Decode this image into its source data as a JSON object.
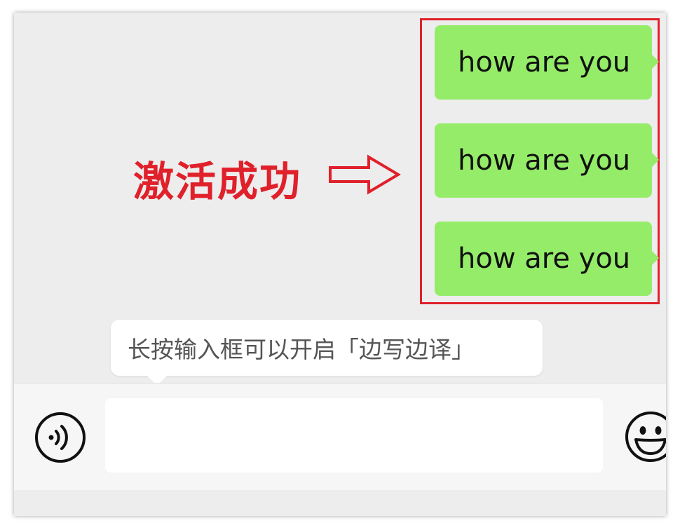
{
  "chat": {
    "messages": [
      {
        "text": "how are you",
        "direction": "outgoing",
        "bubble_color": "#95ec69"
      },
      {
        "text": "how are you",
        "direction": "outgoing",
        "bubble_color": "#95ec69"
      },
      {
        "text": "how are you",
        "direction": "outgoing",
        "bubble_color": "#95ec69"
      }
    ]
  },
  "annotation": {
    "text": "激活成功",
    "color": "#e0202a"
  },
  "tooltip": {
    "text": "长按输入框可以开启「边写边译」"
  },
  "input_bar": {
    "value": "",
    "voice_icon": "voice-icon",
    "emoji_icon": "emoji-icon"
  }
}
